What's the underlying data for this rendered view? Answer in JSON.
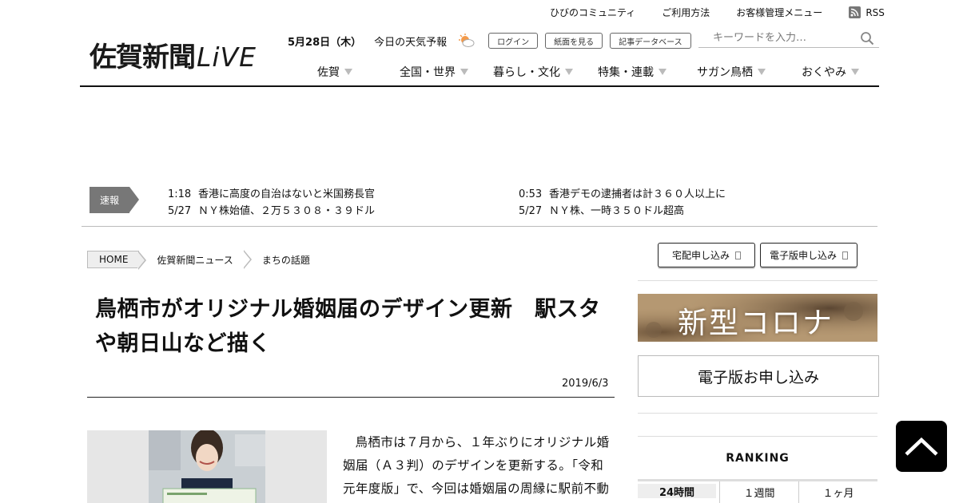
{
  "util": {
    "links": [
      "ひびのコミュニティ",
      "ご利用方法",
      "お客様管理メニュー"
    ],
    "rss": "RSS"
  },
  "logo": {
    "jp": "佐賀新聞",
    "live": "LiVE"
  },
  "daterow": {
    "date": "5月28日（木）",
    "weather": "今日の天気予報",
    "buttons": [
      "ログイン",
      "紙面を見る",
      "記事データベース"
    ]
  },
  "search": {
    "placeholder": "キーワードを入力…"
  },
  "nav": [
    "佐賀",
    "全国・世界",
    "暮らし・文化",
    "特集・連載",
    "サガン鳥栖",
    "おくやみ"
  ],
  "breaking": {
    "label": "速報",
    "left": [
      {
        "time": "1:18",
        "text": "香港に高度の自治はないと米国務長官"
      },
      {
        "time": "5/27",
        "text": "ＮＹ株始値、２万５３０８・３９ドル"
      }
    ],
    "right": [
      {
        "time": "0:53",
        "text": "香港デモの逮捕者は計３６０人以上に"
      },
      {
        "time": "5/27",
        "text": "ＮＹ株、一時３５０ドル超高"
      }
    ]
  },
  "breadcrumb": [
    "HOME",
    "佐賀新聞ニュース",
    "まちの話題"
  ],
  "article": {
    "title": "鳥栖市がオリジナル婚姻届のデザイン更新　駅スタや朝日山など描く",
    "date": "2019/6/3",
    "body": "鳥栖市は７月から、１年ぶりにオリジナル婚姻届（Ａ３判）のデザインを更新する。「令和元年度版」で、今回は婚姻届の周縁に駅前不動"
  },
  "sidebar": {
    "buttons": [
      "宅配申し込み",
      "電子版申し込み"
    ],
    "banner": "新型コロナ",
    "apply": "電子版お申し込み",
    "ranking": "RANKING",
    "tabs": [
      "24時間",
      "１週間",
      "１ヶ月"
    ]
  },
  "colors": {
    "banner": "#a78a66",
    "breaking": "#777777"
  }
}
